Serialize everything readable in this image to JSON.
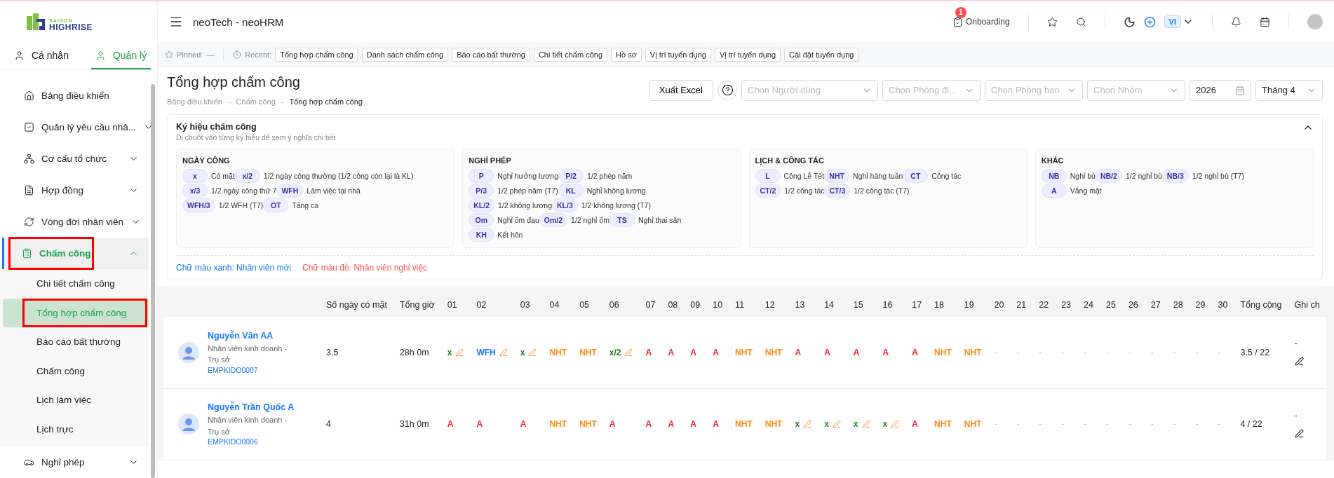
{
  "logo": {
    "line1": "SAIGON",
    "line2": "HIGHRISE"
  },
  "sidebar_tabs": [
    {
      "label": "Cá nhân",
      "selected": false
    },
    {
      "label": "Quản lý",
      "selected": true
    }
  ],
  "menu": [
    {
      "label": "Bảng điều khiển",
      "selected": false,
      "highlighted": false
    },
    {
      "label": "Quản lý yêu cầu nhâ...",
      "expanded": false,
      "selected": false,
      "highlighted": false
    },
    {
      "label": "Cơ cấu tổ chức",
      "expanded": false,
      "selected": false,
      "highlighted": false
    },
    {
      "label": "Hợp đồng",
      "expanded": false,
      "selected": false,
      "highlighted": false
    },
    {
      "label": "Vòng đời nhân viên",
      "expanded": false,
      "selected": false,
      "highlighted": false
    },
    {
      "label": "Chấm công",
      "expanded": true,
      "selected": true,
      "highlighted": true,
      "children": [
        {
          "label": "Chi tiết chấm công",
          "selected": false,
          "highlighted": false
        },
        {
          "label": "Tổng hợp chấm công",
          "selected": true,
          "highlighted": true
        },
        {
          "label": "Báo cáo bất thường",
          "selected": false,
          "highlighted": false
        },
        {
          "label": "Chấm công",
          "selected": false,
          "highlighted": false
        },
        {
          "label": "Lịch làm việc",
          "selected": false,
          "highlighted": false
        },
        {
          "label": "Lịch trực",
          "selected": false,
          "highlighted": false
        }
      ]
    },
    {
      "label": "Nghỉ phép",
      "expanded": false,
      "selected": false,
      "highlighted": false
    }
  ],
  "header": {
    "title": "neoTech - neoHRM",
    "onboarding": {
      "label": "Onboarding",
      "badge": "1"
    },
    "language": "VI"
  },
  "pinned": {
    "label": "Pinned:",
    "value": "—"
  },
  "recent": {
    "label": "Recent:",
    "items": [
      "Tổng hợp chấm công",
      "Danh sách chấm công",
      "Báo cáo bất thường",
      "Chi tiết chấm công",
      "Hồ sơ",
      "Vị trí tuyển dụng",
      "Vị trí tuyển dụng",
      "Cài đặt tuyển dụng"
    ]
  },
  "page": {
    "title": "Tổng hợp chấm công",
    "breadcrumbs": [
      {
        "kind": "link",
        "text": "Bảng điều khiển"
      },
      {
        "kind": "separator",
        "text": "-"
      },
      {
        "kind": "link",
        "text": "Chấm công"
      },
      {
        "kind": "separator",
        "text": "-"
      },
      {
        "kind": "current",
        "text": "Tổng hợp chấm công"
      }
    ]
  },
  "toolbar": {
    "export": "Xuất Excel",
    "filters": [
      {
        "kind": "select",
        "placeholder": "Chọn Người dùng"
      },
      {
        "kind": "select",
        "placeholder": "Chọn Phòng đi..."
      },
      {
        "kind": "select",
        "placeholder": "Chọn Phòng ban"
      },
      {
        "kind": "select",
        "placeholder": "Chọn Nhóm"
      },
      {
        "kind": "year",
        "value": "2026"
      },
      {
        "kind": "select",
        "value": "Tháng 4"
      }
    ]
  },
  "legend": {
    "title": "Ký hiệu chấm công",
    "subtitle": "Di chuột vào từng ký hiệu để xem ý nghĩa chi tiết",
    "expanded": true,
    "groups": [
      {
        "title": "NGÀY CÔNG",
        "lines": [
          [
            {
              "code": "x",
              "label": "Có mặt"
            },
            {
              "code": "x/2",
              "label": "1/2 ngày công thường (1/2 công còn lại là KL)"
            }
          ],
          [
            {
              "code": "x/3",
              "label": "1/2 ngày công thứ 7"
            },
            {
              "code": "WFH",
              "label": "Làm việc tại nhà"
            }
          ],
          [
            {
              "code": "WFH/3",
              "label": "1/2 WFH (T7)"
            },
            {
              "code": "OT",
              "label": "Tăng ca"
            }
          ]
        ]
      },
      {
        "title": "NGHỈ PHÉP",
        "lines": [
          [
            {
              "code": "P",
              "label": "Nghỉ hưởng lương"
            },
            {
              "code": "P/2",
              "label": "1/2 phép năm"
            }
          ],
          [
            {
              "code": "P/3",
              "label": "1/2 phép năm (T7)"
            },
            {
              "code": "KL",
              "label": "Nghỉ không lương"
            }
          ],
          [
            {
              "code": "KL/2",
              "label": "1/2 không lương"
            },
            {
              "code": "KL/3",
              "label": "1/2 không lương (T7)"
            }
          ],
          [
            {
              "code": "Om",
              "label": "Nghỉ ốm đau"
            },
            {
              "code": "Om/2",
              "label": "1/2 nghỉ ốm"
            },
            {
              "code": "TS",
              "label": "Nghỉ thai sản"
            }
          ],
          [
            {
              "code": "KH",
              "label": "Kết hôn"
            }
          ]
        ]
      },
      {
        "title": "LỊCH & CÔNG TÁC",
        "lines": [
          [
            {
              "code": "L",
              "label": "Công Lễ Tết"
            },
            {
              "code": "NHT",
              "label": "Nghỉ hàng tuần"
            },
            {
              "code": "CT",
              "label": "Công tác"
            }
          ],
          [
            {
              "code": "CT/2",
              "label": "1/2 công tác"
            },
            {
              "code": "CT/3",
              "label": "1/2 công tác (T7)"
            }
          ]
        ]
      },
      {
        "title": "KHÁC",
        "lines": [
          [
            {
              "code": "NB",
              "label": "Nghỉ bù"
            },
            {
              "code": "NB/2",
              "label": "1/2 nghỉ bù"
            },
            {
              "code": "NB/3",
              "label": "1/2 nghỉ bù (T7)"
            }
          ],
          [
            {
              "code": "A",
              "label": "Vắng mặt"
            }
          ]
        ]
      }
    ],
    "notes": [
      {
        "text": "Chữ màu xanh: Nhân viên mới",
        "color": "#1677ff"
      },
      {
        "text": "Chữ màu đỏ: Nhân viên nghỉ việc",
        "color": "#ff4d4f"
      }
    ]
  },
  "table": {
    "columns": [
      "",
      "Số ngày có mặt",
      "Tổng giờ",
      "01",
      "02",
      "03",
      "04",
      "05",
      "06",
      "07",
      "08",
      "09",
      "10",
      "11",
      "12",
      "13",
      "14",
      "15",
      "16",
      "17",
      "18",
      "19",
      "20",
      "21",
      "22",
      "23",
      "24",
      "25",
      "26",
      "27",
      "28",
      "29",
      "30",
      "Tổng cộng",
      "Ghi ch"
    ],
    "rows": [
      {
        "cells": [
          {
            "kind": "employee",
            "name": "Nguyễn Văn AA",
            "position": "Nhân viên kinh doanh - Trụ sở",
            "code": "EMPKIDO0007"
          },
          {
            "kind": "value",
            "text": "3.5"
          },
          {
            "kind": "value",
            "text": "28h 0m"
          },
          {
            "code": "x",
            "kind": "present",
            "editable": true
          },
          {
            "code": "WFH",
            "kind": "wfh",
            "editable": true
          },
          {
            "code": "x",
            "kind": "present",
            "editable": true
          },
          {
            "code": "NHT",
            "kind": "weekly_off",
            "editable": false
          },
          {
            "code": "NHT",
            "kind": "weekly_off",
            "editable": false
          },
          {
            "code": "x/2",
            "kind": "present",
            "editable": true
          },
          {
            "code": "A",
            "kind": "absent",
            "editable": false
          },
          {
            "code": "A",
            "kind": "absent",
            "editable": false
          },
          {
            "code": "A",
            "kind": "absent",
            "editable": false
          },
          {
            "code": "A",
            "kind": "absent",
            "editable": false
          },
          {
            "code": "NHT",
            "kind": "weekly_off",
            "editable": false
          },
          {
            "code": "NHT",
            "kind": "weekly_off",
            "editable": false
          },
          {
            "code": "A",
            "kind": "absent",
            "editable": false
          },
          {
            "code": "A",
            "kind": "absent",
            "editable": false
          },
          {
            "code": "A",
            "kind": "absent",
            "editable": false
          },
          {
            "code": "A",
            "kind": "absent",
            "editable": false
          },
          {
            "code": "A",
            "kind": "absent",
            "editable": false
          },
          {
            "code": "NHT",
            "kind": "weekly_off",
            "editable": false
          },
          {
            "code": "NHT",
            "kind": "weekly_off",
            "editable": false
          },
          {
            "code": "-",
            "kind": "none",
            "editable": false
          },
          {
            "code": "-",
            "kind": "none",
            "editable": false
          },
          {
            "code": "-",
            "kind": "none",
            "editable": false
          },
          {
            "code": "-",
            "kind": "none",
            "editable": false
          },
          {
            "code": "-",
            "kind": "none",
            "editable": false
          },
          {
            "code": "-",
            "kind": "none",
            "editable": false
          },
          {
            "code": "-",
            "kind": "none",
            "editable": false
          },
          {
            "code": "-",
            "kind": "none",
            "editable": false
          },
          {
            "code": "-",
            "kind": "none",
            "editable": false
          },
          {
            "code": "-",
            "kind": "none",
            "editable": false
          },
          {
            "code": "-",
            "kind": "none",
            "editable": false
          },
          {
            "kind": "value",
            "text": "3.5 / 22"
          },
          {
            "kind": "note",
            "text": "-",
            "editable": true
          }
        ]
      },
      {
        "cells": [
          {
            "kind": "employee",
            "name": "Nguyễn Trần Quốc A",
            "position": "Nhân viên kinh doanh - Trụ sở",
            "code": "EMPKIDO0006"
          },
          {
            "kind": "value",
            "text": "4"
          },
          {
            "kind": "value",
            "text": "31h 0m"
          },
          {
            "code": "A",
            "kind": "absent",
            "editable": false
          },
          {
            "code": "A",
            "kind": "absent",
            "editable": false
          },
          {
            "code": "A",
            "kind": "absent",
            "editable": false
          },
          {
            "code": "NHT",
            "kind": "weekly_off",
            "editable": false
          },
          {
            "code": "NHT",
            "kind": "weekly_off",
            "editable": false
          },
          {
            "code": "A",
            "kind": "absent",
            "editable": false
          },
          {
            "code": "A",
            "kind": "absent",
            "editable": false
          },
          {
            "code": "A",
            "kind": "absent",
            "editable": false
          },
          {
            "code": "A",
            "kind": "absent",
            "editable": false
          },
          {
            "code": "A",
            "kind": "absent",
            "editable": false
          },
          {
            "code": "NHT",
            "kind": "weekly_off",
            "editable": false
          },
          {
            "code": "NHT",
            "kind": "weekly_off",
            "editable": false
          },
          {
            "code": "x",
            "kind": "present",
            "editable": true
          },
          {
            "code": "x",
            "kind": "present",
            "editable": true
          },
          {
            "code": "x",
            "kind": "present",
            "editable": true
          },
          {
            "code": "x",
            "kind": "present",
            "editable": true
          },
          {
            "code": "A",
            "kind": "absent",
            "editable": false
          },
          {
            "code": "NHT",
            "kind": "weekly_off",
            "editable": false
          },
          {
            "code": "NHT",
            "kind": "weekly_off",
            "editable": false
          },
          {
            "code": "-",
            "kind": "none",
            "editable": false
          },
          {
            "code": "-",
            "kind": "none",
            "editable": false
          },
          {
            "code": "-",
            "kind": "none",
            "editable": false
          },
          {
            "code": "-",
            "kind": "none",
            "editable": false
          },
          {
            "code": "-",
            "kind": "none",
            "editable": false
          },
          {
            "code": "-",
            "kind": "none",
            "editable": false
          },
          {
            "code": "-",
            "kind": "none",
            "editable": false
          },
          {
            "code": "-",
            "kind": "none",
            "editable": false
          },
          {
            "code": "-",
            "kind": "none",
            "editable": false
          },
          {
            "code": "-",
            "kind": "none",
            "editable": false
          },
          {
            "code": "-",
            "kind": "none",
            "editable": false
          },
          {
            "kind": "value",
            "text": "4 / 22"
          },
          {
            "kind": "note",
            "text": "-",
            "editable": true
          }
        ]
      }
    ]
  }
}
